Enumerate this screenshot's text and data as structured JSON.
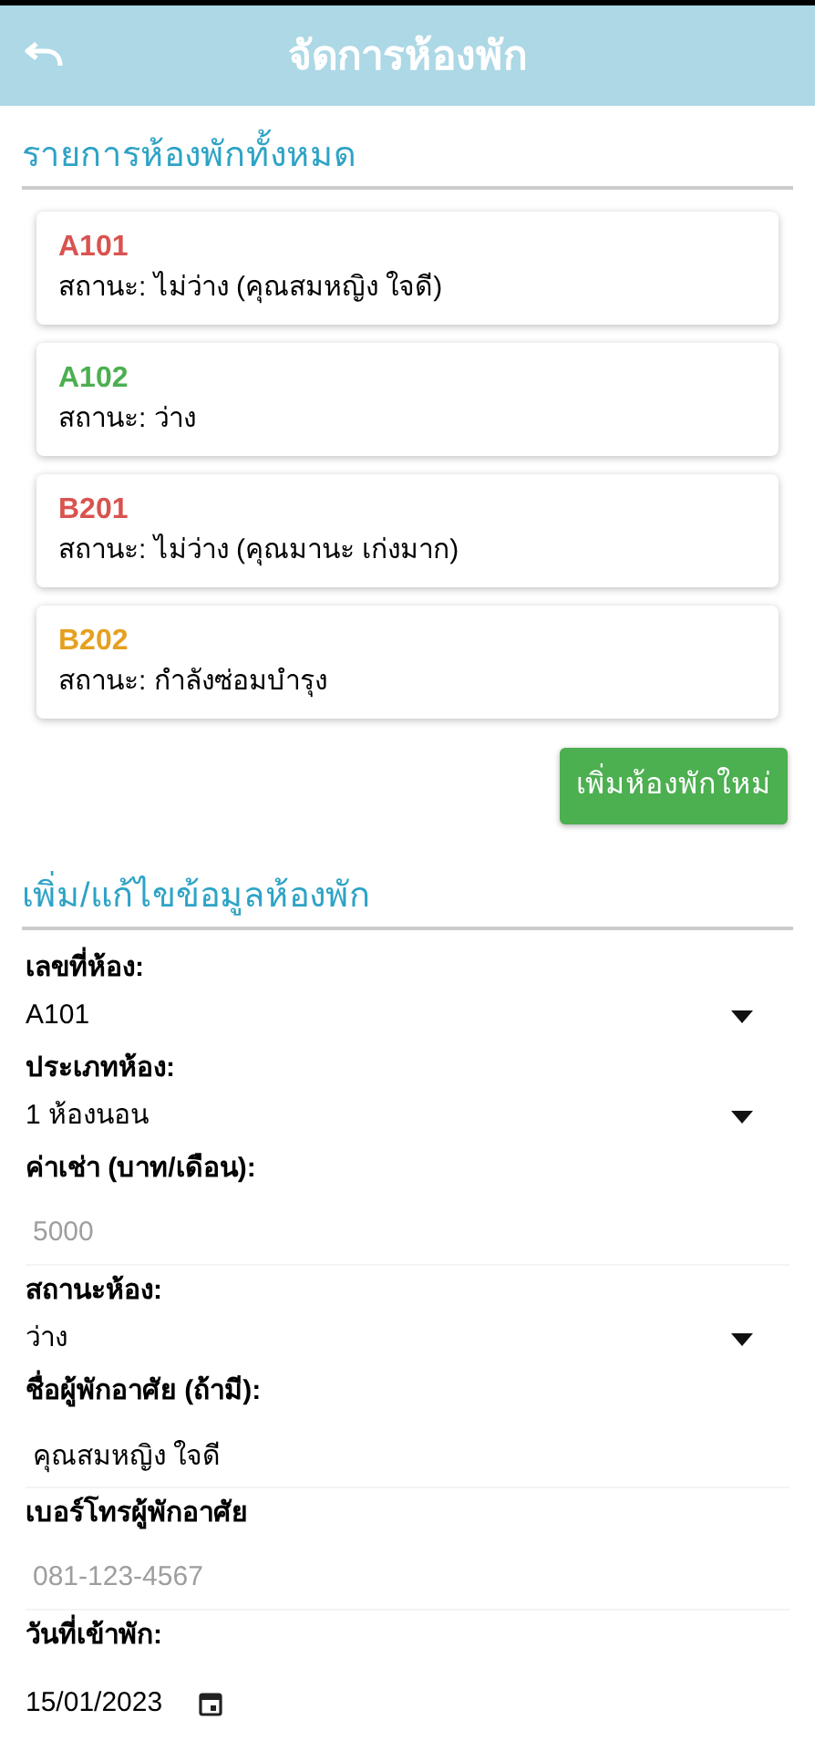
{
  "header": {
    "title": "จัดการห้องพัก"
  },
  "rooms_section": {
    "title": "รายการห้องพักทั้งหมด"
  },
  "rooms": [
    {
      "number": "A101",
      "status": "สถานะ: ไม่ว่าง (คุณสมหญิง ใจดี)",
      "color": "#d9534f"
    },
    {
      "number": "A102",
      "status": "สถานะ: ว่าง",
      "color": "#4caf50"
    },
    {
      "number": "B201",
      "status": "สถานะ: ไม่ว่าง (คุณมานะ เก่งมาก)",
      "color": "#d9534f"
    },
    {
      "number": "B202",
      "status": "สถานะ: กำลังซ่อมบำรุง",
      "color": "#e6a020"
    }
  ],
  "add_button": "เพิ่มห้องพักใหม่",
  "form_section": {
    "title": "เพิ่ม/แก้ไขข้อมูลห้องพัก"
  },
  "fields": [
    {
      "kind": "select",
      "label": "เลขที่ห้อง:",
      "value": "A101"
    },
    {
      "kind": "select",
      "label": "ประเภทห้อง:",
      "value": "1 ห้องนอน"
    },
    {
      "kind": "input",
      "label": "ค่าเช่า (บาท/เดือน):",
      "placeholder": "5000"
    },
    {
      "kind": "select",
      "label": "สถานะห้อง:",
      "value": "ว่าง"
    },
    {
      "kind": "input",
      "label": "ชื่อผู้พักอาศัย (ถ้ามี):",
      "value": "คุณสมหญิง ใจดี"
    },
    {
      "kind": "input",
      "label": "เบอร์โทรผู้พักอาศัย",
      "placeholder": "081-123-4567"
    },
    {
      "kind": "date",
      "label": "วันที่เข้าพัก:",
      "value": "15/01/2023"
    }
  ]
}
